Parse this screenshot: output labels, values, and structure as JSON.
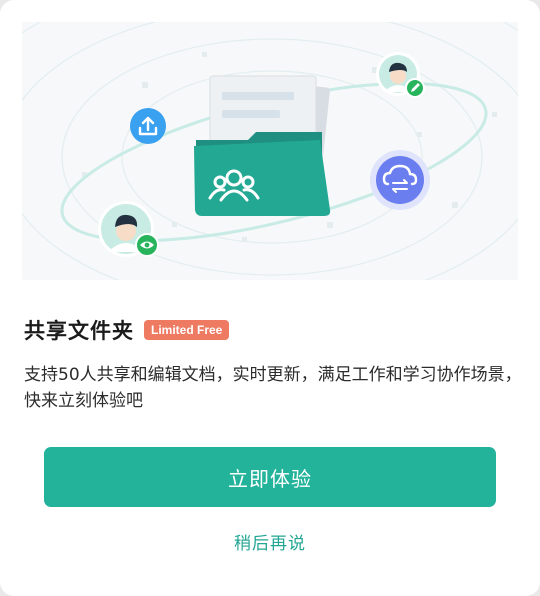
{
  "dialog": {
    "title": "共享文件夹",
    "badge": "Limited Free",
    "description": "支持50人共享和编辑文档，实时更新，满足工作和学习协作场景，快来立刻体验吧",
    "primary_button": "立即体验",
    "later_link": "稍后再说"
  },
  "illustration": {
    "icons": [
      "folder-users-icon",
      "upload-icon",
      "cloud-sync-icon",
      "avatar-editor-icon",
      "avatar-viewer-icon",
      "pencil-icon",
      "eye-icon"
    ]
  },
  "colors": {
    "accent": "#23b39b",
    "badge": "#ef7a62",
    "folder": "#1f9e8c",
    "upload_bubble": "#3aa0f0",
    "cloud_bubble": "#6b7ef0",
    "green_badge": "#27b45c"
  }
}
